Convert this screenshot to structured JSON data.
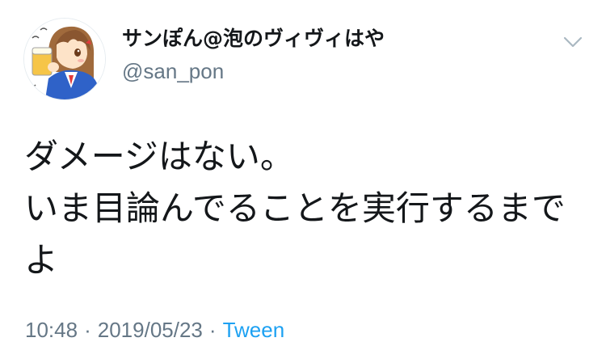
{
  "tweet": {
    "display_name": "サンぽん@泡のヴィヴィはや",
    "handle": "@san_pon",
    "text": "ダメージはない。\nいま目論んでることを実行するまでよ",
    "time": "10:48",
    "date": "2019/05/23",
    "separator": "·",
    "source": "Tween",
    "avatar_icon": "user-avatar-anime-girl-drinking",
    "menu_icon": "chevron-down-icon"
  },
  "colors": {
    "text": "#14171a",
    "secondary": "#657786",
    "link": "#1da1f2",
    "background": "#ffffff"
  }
}
